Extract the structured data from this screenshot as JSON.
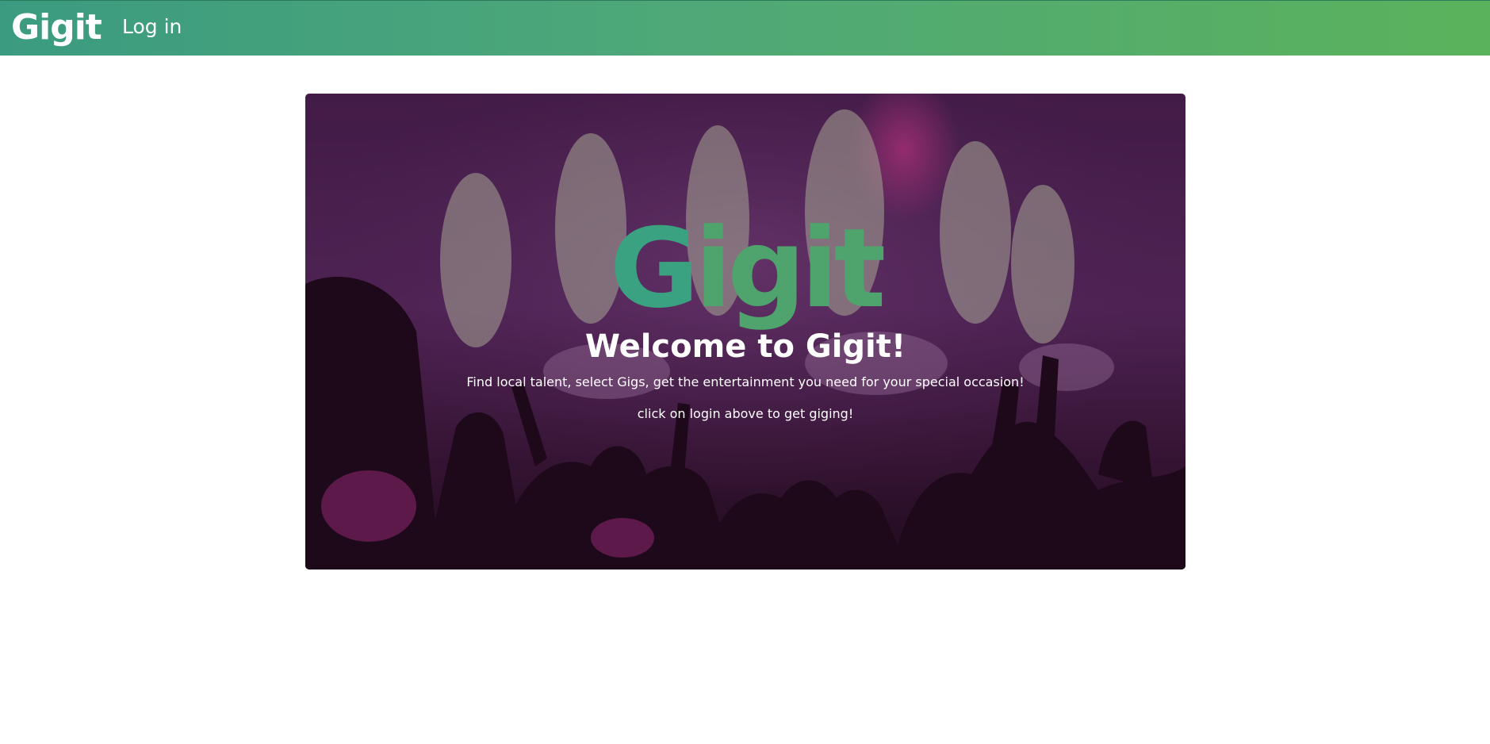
{
  "navbar": {
    "brand": "Gigit",
    "login_label": "Log in",
    "gradient_start": "#3b9b80",
    "gradient_end": "#5bb25c"
  },
  "hero": {
    "logo_first": "G",
    "logo_rest": "igit",
    "title": "Welcome to Gigit!",
    "subtitle": "Find local talent, select Gigs, get the entertainment you need for your special occasion!",
    "cta_text": "click on login above to get giging!",
    "background_description_icon": "concert-crowd-image"
  }
}
